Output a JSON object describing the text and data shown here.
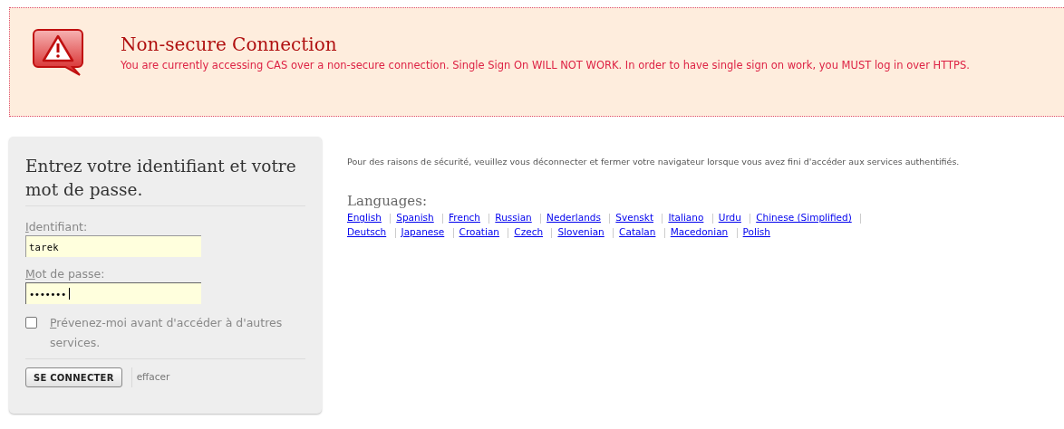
{
  "warning": {
    "title": "Non-secure Connection",
    "message": "You are currently accessing CAS over a non-secure connection. Single Sign On WILL NOT WORK. In order to have single sign on work, you MUST log in over HTTPS."
  },
  "login": {
    "heading": "Entrez votre identifiant et votre mot de passe.",
    "fields": [
      {
        "label": "Identifiant:",
        "kind": "text",
        "value": "tarek",
        "focused": false
      },
      {
        "label": "Mot de passe:",
        "kind": "password",
        "value": "•••••••",
        "focused": true
      }
    ],
    "warn_checkbox": {
      "label": "Prévenez-moi avant d'accéder à d'autres services.",
      "checked": false
    },
    "submit": "SE CONNECTER",
    "reset": "effacer"
  },
  "notice": "Pour des raisons de sécurité, veuillez vous déconnecter et fermer votre navigateur lorsque vous avez fini d'accéder aux services authentifiés.",
  "languages": {
    "title": "Languages:",
    "items": [
      "English",
      "Spanish",
      "French",
      "Russian",
      "Nederlands",
      "Svenskt",
      "Italiano",
      "Urdu",
      "Chinese (Simplified)",
      "Deutsch",
      "Japanese",
      "Croatian",
      "Czech",
      "Slovenian",
      "Catalan",
      "Macedonian",
      "Polish"
    ]
  }
}
